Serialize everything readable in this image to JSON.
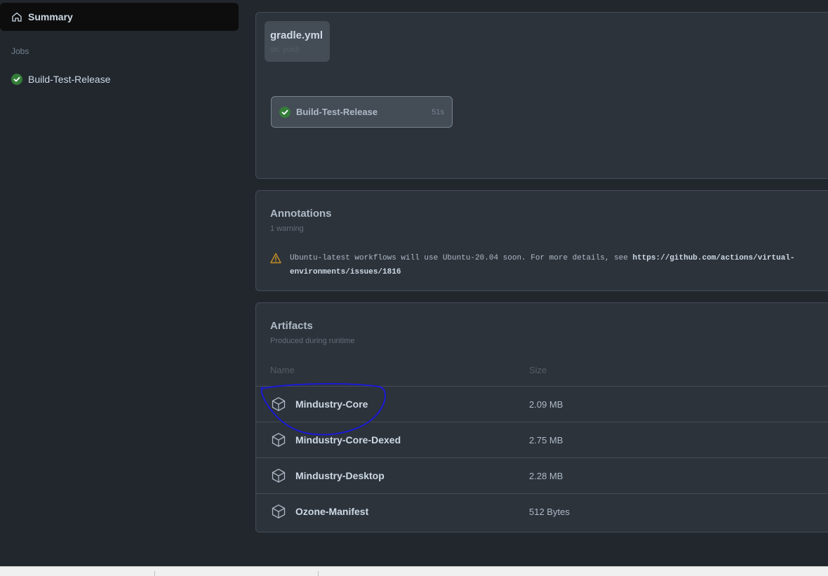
{
  "sidebar": {
    "summary_label": "Summary",
    "jobs_heading": "Jobs",
    "jobs": [
      {
        "label": "Build-Test-Release",
        "status": "success"
      }
    ]
  },
  "graph": {
    "workflow_name": "gradle.yml",
    "workflow_trigger": "on: push",
    "job": {
      "label": "Build-Test-Release",
      "duration": "51s",
      "status": "success"
    }
  },
  "annotations": {
    "title": "Annotations",
    "subtitle": "1 warning",
    "items": [
      {
        "level": "warning",
        "text": "Ubuntu-latest workflows will use Ubuntu-20.04 soon. For more details, see ",
        "link": "https://github.com/actions/virtual-environments/issues/1816"
      }
    ]
  },
  "artifacts": {
    "title": "Artifacts",
    "subtitle": "Produced during runtime",
    "columns": {
      "name": "Name",
      "size": "Size"
    },
    "rows": [
      {
        "name": "Mindustry-Core",
        "size": "2.09 MB"
      },
      {
        "name": "Mindustry-Core-Dexed",
        "size": "2.75 MB"
      },
      {
        "name": "Mindustry-Desktop",
        "size": "2.28 MB"
      },
      {
        "name": "Ozone-Manifest",
        "size": "512 Bytes"
      }
    ]
  },
  "colors": {
    "background": "#22272e",
    "panel": "#2d333b",
    "success": "#57ab5a",
    "warning": "#c69026",
    "annotation_ink": "#1a1ad6"
  }
}
